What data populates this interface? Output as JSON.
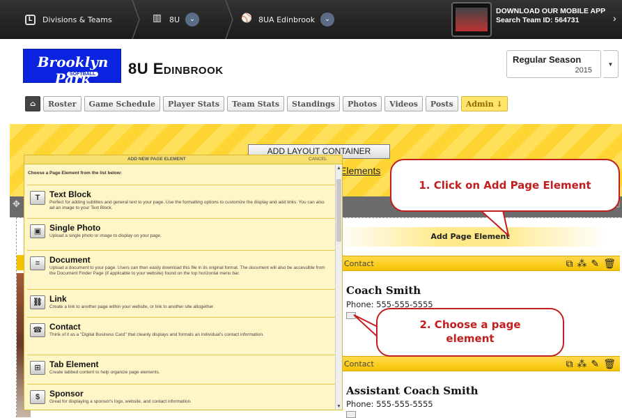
{
  "topbar": {
    "crumbs": [
      {
        "label": "Divisions & Teams",
        "icon": "league-shield-icon"
      },
      {
        "label": "8U",
        "icon": "chart-icon"
      },
      {
        "label": "8UA Edinbrook",
        "icon": "softball-bat-icon"
      }
    ],
    "app_line1": "DOWNLOAD OUR MOBILE APP",
    "app_line2": "Search Team ID: 564731"
  },
  "header": {
    "logo_text": "Brooklyn Park",
    "logo_sub": "SOFTBALL",
    "team_title": "8U Edinbrook",
    "season_label": "Regular Season",
    "season_year": "2015"
  },
  "nav": {
    "home_icon": "home-icon",
    "tabs": [
      "Roster",
      "Game Schedule",
      "Player Stats",
      "Team Stats",
      "Standings",
      "Photos",
      "Videos",
      "Posts"
    ],
    "admin": "Admin ↓"
  },
  "layout": {
    "add_layout_container": "ADD LAYOUT CONTAINER",
    "elements_link": "Elements",
    "add_page_element": "Add Page Element"
  },
  "panel": {
    "title": "ADD NEW PAGE ELEMENT",
    "cancel": "CANCEL",
    "intro": "Choose a Page Element from the list below:",
    "items": [
      {
        "name": "Text Block",
        "desc": "Perfect for adding subtitles and general text to your page. Use the formatting options to customize the display and add links. You can also ad an image to your Text Block.",
        "icon": "T"
      },
      {
        "name": "Single Photo",
        "desc": "Upload a single photo or image to display on your page.",
        "icon": "▣"
      },
      {
        "name": "Document",
        "desc": "Upload a document to your page. Users can then easily download this file in its original format. The document will also be accessible from the Document Finder Page (if applicable to your website) found on the top horizontal menu bar.",
        "icon": "≡"
      },
      {
        "name": "Link",
        "desc": "Create a link to another page within your website, or link to another site altogether.",
        "icon": "⛓"
      },
      {
        "name": "Contact",
        "desc": "Think of it as a \"Digital Business Card\" that cleanly displays and formats an individual's contact information.",
        "icon": "☎"
      },
      {
        "name": "Tab Element",
        "desc": "Create tabbed content to help organize page elements.",
        "icon": "⊞"
      },
      {
        "name": "Sponsor",
        "desc": "Great for displaying a sponsor's logo, website, and contact information.",
        "icon": "$"
      }
    ]
  },
  "contacts": [
    {
      "section": "Contact",
      "name": "Coach Smith",
      "phone": "Phone: 555-555-5555"
    },
    {
      "section": "Contact",
      "name": "Assistant Coach Smith",
      "phone": "Phone: 555-555-5555"
    }
  ],
  "callouts": {
    "c1": "1. Click on Add Page Element",
    "c2": "2. Choose a page element"
  },
  "colors": {
    "accent_yellow": "#f5c400",
    "logo_blue": "#0a23e0",
    "callout_red": "#c21e1e"
  }
}
